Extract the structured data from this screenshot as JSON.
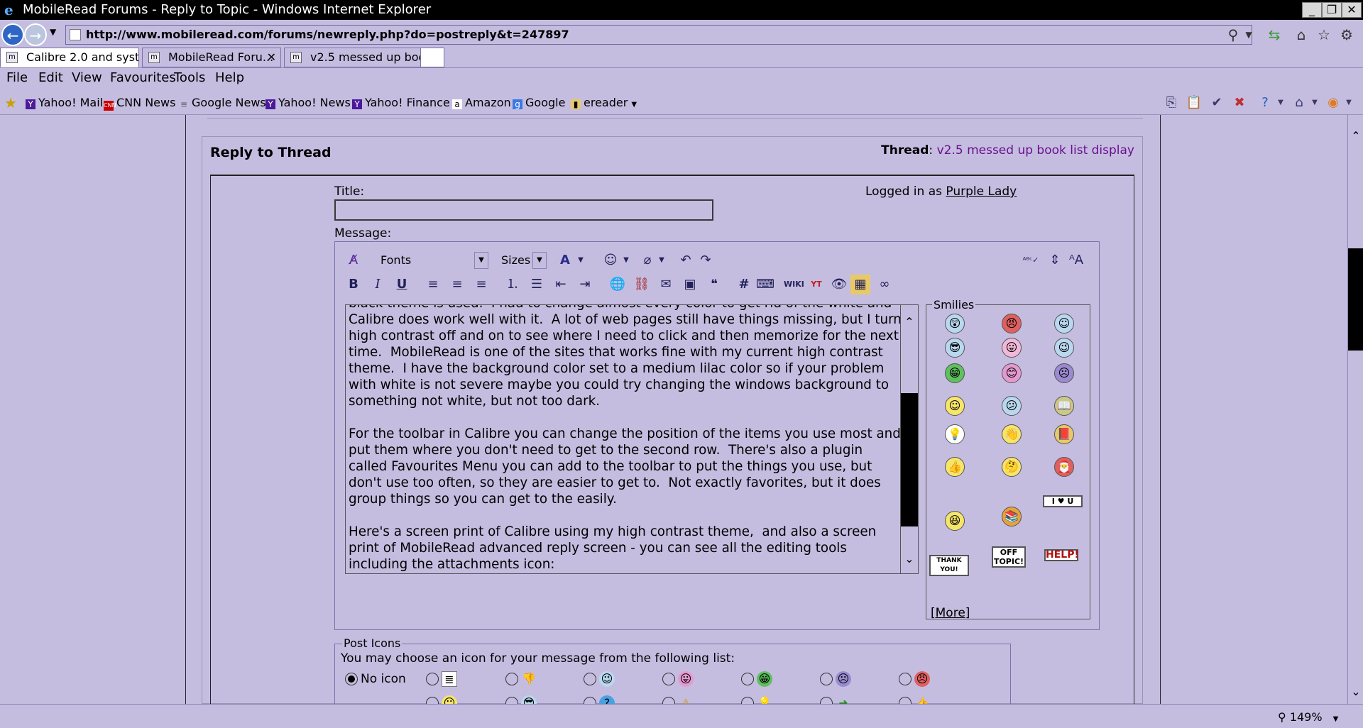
{
  "window": {
    "title": "MobileRead Forums - Reply to Topic - Windows Internet Explorer"
  },
  "address_bar": {
    "url": "http://www.mobileread.com/forums/newreply.php?do=postreply&t=247897"
  },
  "tabs": [
    {
      "label": "Calibre 2.0 and syst...",
      "active": true
    },
    {
      "label": "MobileRead Foru...",
      "active": false
    },
    {
      "label": "v2.5 messed up boo...",
      "active": false
    }
  ],
  "menu": [
    "File",
    "Edit",
    "View",
    "Favourites",
    "Tools",
    "Help"
  ],
  "favorites": [
    {
      "label": "Yahoo! Mail",
      "icon": "yahoo-icon"
    },
    {
      "label": "CNN News",
      "icon": "cnn-icon"
    },
    {
      "label": "Google News",
      "icon": "google-news-icon"
    },
    {
      "label": "Yahoo! News",
      "icon": "yahoo-icon"
    },
    {
      "label": "Yahoo! Finance",
      "icon": "yahoo-icon"
    },
    {
      "label": "Amazon",
      "icon": "amazon-icon"
    },
    {
      "label": "Google",
      "icon": "google-icon"
    },
    {
      "label": "ereader",
      "icon": "folder-icon"
    }
  ],
  "reply": {
    "heading": "Reply to Thread",
    "thread_label": "Thread",
    "thread_title": "v2.5 messed up book list display",
    "title_label": "Title:",
    "title_value": "",
    "message_label": "Message:",
    "logged_in_prefix": "Logged in as",
    "username": "Purple Lady"
  },
  "editor": {
    "font_select": "Fonts",
    "size_select": "Sizes",
    "message_paragraphs": [
      "black theme is used.  I had to change almost every color to get rid of the white and Calibre does work well with it.  A lot of web pages still have things missing, but I turn high contrast off and on to see where I need to click and then memorize for the next time.  MobileRead is one of the sites that works fine with my current high contrast theme.  I have the background color set to a medium lilac color so if your problem with white is not severe maybe you could try changing the windows background to something not white, but not too dark.",
      "For the toolbar in Calibre you can change the position of the items you use most and put them where you don't need to get to the second row.  There's also a plugin called Favourites Menu you can add to the toolbar to put the things you use, but don't use too often, so they are easier to get to.  Not exactly favorites, but it does group things so you can get to the easily.",
      "Here's a screen print of Calibre using my high contrast theme,  and also a screen print of MobileRead advanced reply screen - you can see all the editing tools including the attachments icon:"
    ]
  },
  "smilies": {
    "legend": "Smilies",
    "more": "[More]",
    "signs": [
      "I ♥ U",
      "THANK YOU!",
      "OFF TOPIC!",
      "HELP!"
    ]
  },
  "post_icons": {
    "legend": "Post Icons",
    "description": "You may choose an icon for your message from the following list:",
    "no_icon_label": "No icon"
  },
  "status": {
    "zoom": "149%"
  },
  "colors": {
    "page_background": "#c5bde0",
    "thread_link": "#6a0f8e"
  }
}
